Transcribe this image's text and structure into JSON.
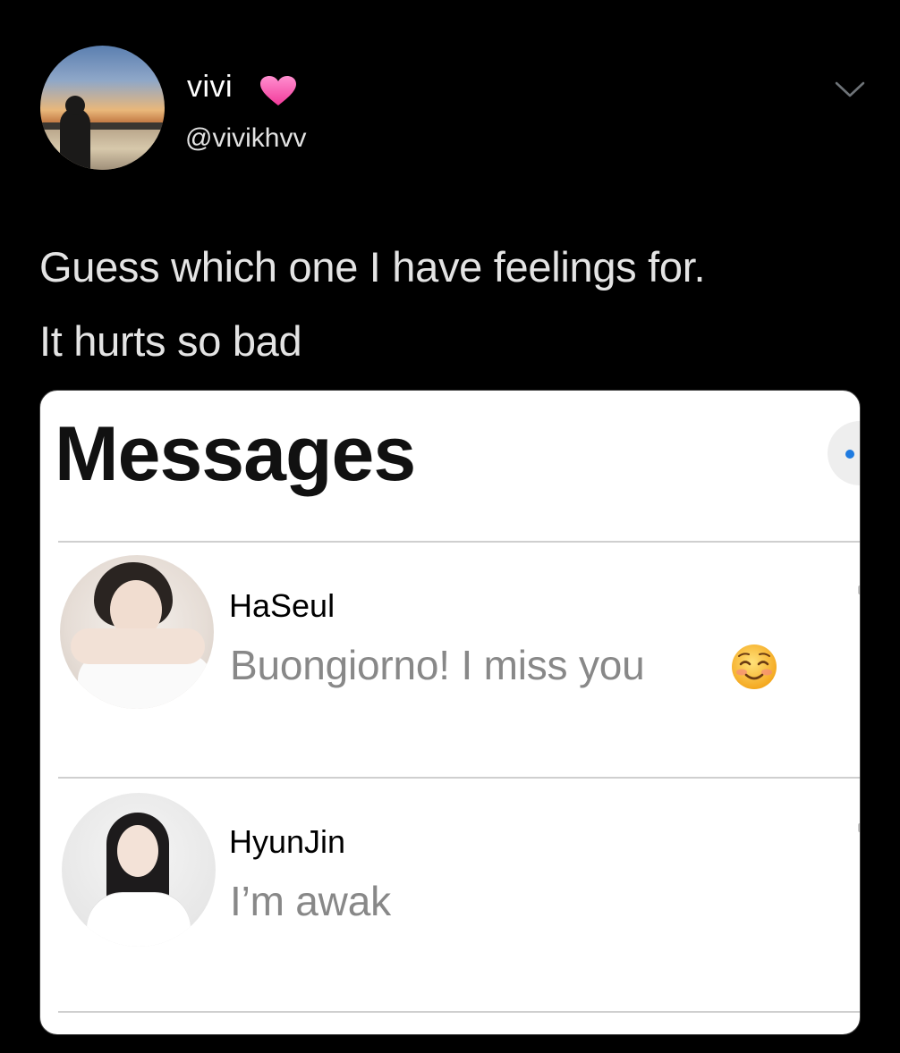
{
  "tweet": {
    "display_name": "vivi",
    "handle": "@vivikhvv",
    "text_lines": [
      "Guess which one I have feelings for.",
      "It hurts so bad"
    ],
    "icons": {
      "verified_emoji": "pink-heart-icon",
      "menu": "chevron-down-icon"
    }
  },
  "media": {
    "title": "Messages",
    "conversations": [
      {
        "name": "HaSeul",
        "preview": "Buongiorno! I miss you",
        "emoji": "smiling-face-icon"
      },
      {
        "name": "HyunJin",
        "preview": "I’m awak"
      }
    ]
  },
  "colors": {
    "background": "#000000",
    "tweet_text": "#e4e4e4",
    "heart": "#ff4fb0",
    "card_background": "#ffffff",
    "preview_text": "#888888",
    "compose_dot": "#1f7be0"
  }
}
